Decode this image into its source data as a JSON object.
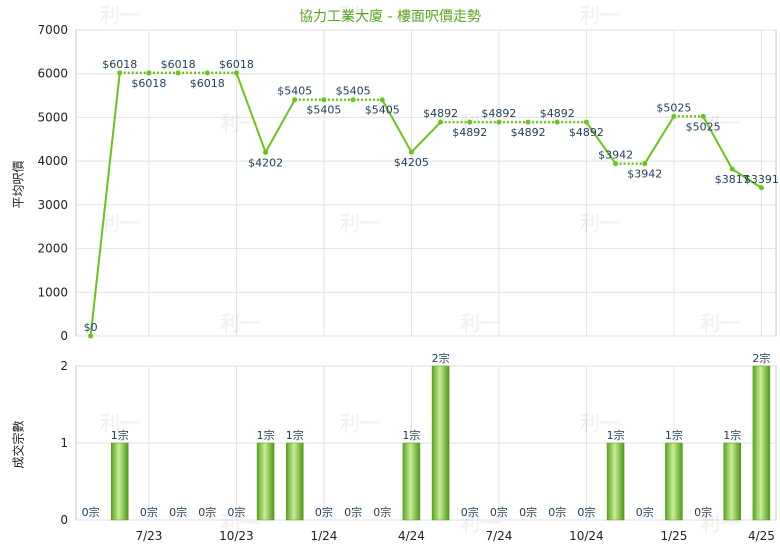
{
  "chart_data": [
    {
      "type": "line",
      "title": "協力工業大廈 - 樓面呎價走勢",
      "ylabel": "平均呎價",
      "ylim": [
        0,
        7000
      ],
      "yticks": [
        0,
        1000,
        2000,
        3000,
        4000,
        5000,
        6000,
        7000
      ],
      "xticks": [
        "7/23",
        "10/23",
        "1/24",
        "4/24",
        "7/24",
        "10/24",
        "1/25",
        "4/25"
      ],
      "series": [
        {
          "values": [
            0,
            6018,
            6018,
            6018,
            6018,
            6018,
            4202,
            5405,
            5405,
            5405,
            5405,
            4205,
            4892,
            4892,
            4892,
            4892,
            4892,
            4892,
            3942,
            3942,
            5025,
            5025,
            3817,
            3391
          ],
          "labels": [
            "$0",
            "$6018",
            "$6018",
            "$6018",
            "$6018",
            "$6018",
            "$4202",
            "$5405",
            "$5405",
            "$5405",
            "$5405",
            "$4205",
            "$4892",
            "$4892",
            "$4892",
            "$4892",
            "$4892",
            "$4892",
            "$3942",
            "$3942",
            "$5025",
            "$5025",
            "$3817",
            "$3391"
          ]
        }
      ],
      "grid": true,
      "color": "#6cc31c"
    },
    {
      "type": "bar",
      "ylabel": "成交宗數",
      "ylim": [
        0,
        2
      ],
      "yticks": [
        0,
        1,
        2
      ],
      "series": [
        {
          "values": [
            0,
            1,
            0,
            0,
            0,
            0,
            1,
            1,
            0,
            0,
            0,
            1,
            2,
            0,
            0,
            0,
            0,
            0,
            1,
            0,
            1,
            0,
            1,
            2
          ],
          "labels": [
            "0宗",
            "1宗",
            "0宗",
            "0宗",
            "0宗",
            "0宗",
            "1宗",
            "1宗",
            "0宗",
            "0宗",
            "0宗",
            "1宗",
            "2宗",
            "0宗",
            "0宗",
            "0宗",
            "0宗",
            "0宗",
            "1宗",
            "0宗",
            "1宗",
            "0宗",
            "1宗",
            "2宗"
          ]
        }
      ],
      "grid": true,
      "color": "#6cc31c"
    }
  ],
  "watermark": "利一"
}
